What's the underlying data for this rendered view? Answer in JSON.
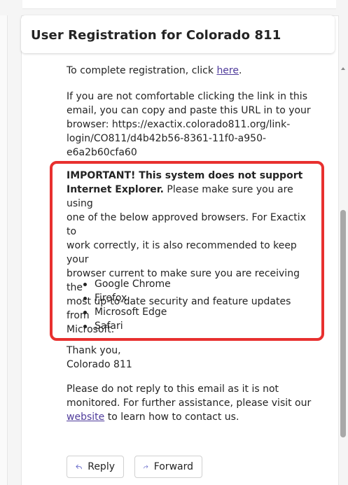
{
  "email": {
    "subject": "User Registration for Colorado 811",
    "intro_prefix": "To complete registration, click ",
    "intro_link": "here",
    "intro_suffix": ".",
    "copy_paste_line1": "If you are not comfortable clicking the link in this",
    "copy_paste_line2": "email, you can copy and paste this URL in to your",
    "copy_paste_line3": "browser: https://exactix.colorado811.org/link-",
    "copy_paste_line4": "login/CO811/d4b42b56-8361-11f0-a950-",
    "copy_paste_line5": "e6a2b60cfa60",
    "important_bold_line1": "IMPORTANT! This system does not support",
    "important_bold_line2": "Internet Explorer.",
    "important_rest_line2": " Please make sure you are using",
    "important_line3": "one of the below approved browsers. For Exactix to",
    "important_line4": "work correctly, it is also recommended to keep your",
    "important_line5": "browser current to make sure you are receiving the",
    "important_line6": "most up-to-date security and feature updates from",
    "important_line7": "Microsoft.",
    "browsers": [
      "Google Chrome",
      "Firefox",
      "Microsoft Edge",
      "Safari"
    ],
    "thanks": "Thank you,",
    "signature": "Colorado 811",
    "closing_line1": "Please do not reply to this email as it is not",
    "closing_line2": "monitored. For further assistance, please visit our",
    "closing_link": "website",
    "closing_suffix": " to learn how to contact us."
  },
  "actions": {
    "reply_label": "Reply",
    "forward_label": "Forward"
  },
  "colors": {
    "highlight_border": "#e8302f",
    "link": "#4f3b9b",
    "text": "#242424"
  }
}
